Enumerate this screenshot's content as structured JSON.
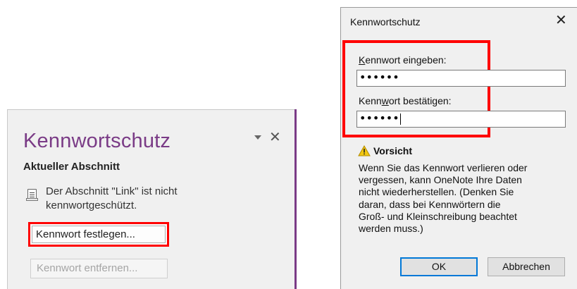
{
  "pane": {
    "title": "Kennwortschutz",
    "section_heading": "Aktueller Abschnitt",
    "info_line1": "Der Abschnitt \"Link\" ist nicht",
    "info_line2": "kennwortgeschützt.",
    "set_password_button": "Kennwort festlegen...",
    "remove_password_button": "Kennwort entfernen...",
    "accent_color": "#7a3b86"
  },
  "dialog": {
    "title": "Kennwortschutz",
    "close_glyph": "✕",
    "enter_label_underlined": "K",
    "enter_label_rest": "ennwort eingeben:",
    "enter_value": "••••••",
    "confirm_label_pre": "Kenn",
    "confirm_label_underlined": "w",
    "confirm_label_post": "ort bestätigen:",
    "confirm_value": "••••••",
    "warning_title": "Vorsicht",
    "warning_lines": [
      "Wenn Sie das Kennwort verlieren oder",
      "vergessen, kann OneNote Ihre Daten",
      "nicht wiederherstellen. (Denken Sie",
      "daran, dass bei Kennwörtern die",
      "Groß- und Kleinschreibung beachtet",
      "werden muss.)"
    ],
    "ok_button": "OK",
    "cancel_button": "Abbrechen",
    "highlight_color": "#ff0000",
    "default_button_color": "#0078d7"
  }
}
